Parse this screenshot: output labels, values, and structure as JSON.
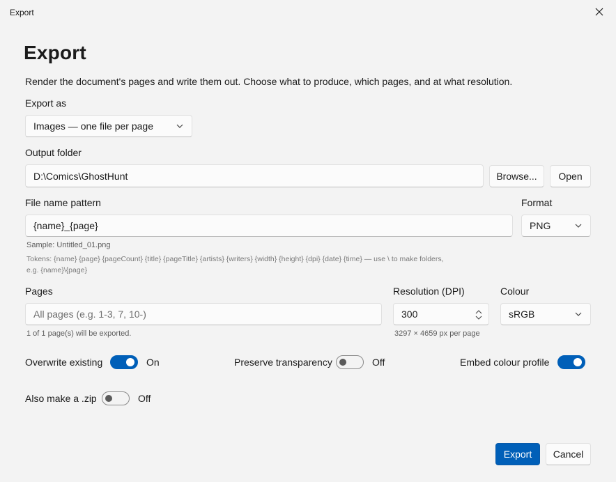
{
  "window": {
    "title": "Export",
    "close_icon": "close-icon"
  },
  "heading": "Export",
  "description": "Render the document's pages and write them out. Choose what to produce, which pages, and at what resolution.",
  "export_as": {
    "label": "Export as",
    "value": "Images — one file per page"
  },
  "output_folder": {
    "label": "Output folder",
    "value": "D:\\Comics\\GhostHunt",
    "browse_label": "Browse...",
    "open_label": "Open"
  },
  "file_name": {
    "label": "File name pattern",
    "value": "{name}_{page}",
    "sample": "Sample: Untitled_01.png",
    "tokens_line1": "Tokens: {name} {page} {pageCount} {title} {pageTitle} {artists} {writers} {width} {height} {dpi} {date} {time} — use \\ to make folders,",
    "tokens_line2": "e.g. {name}\\{page}"
  },
  "format": {
    "label": "Format",
    "value": "PNG"
  },
  "pages": {
    "label": "Pages",
    "placeholder": "All pages (e.g. 1-3, 7, 10-)",
    "hint": "1 of 1 page(s) will be exported."
  },
  "resolution": {
    "label": "Resolution (DPI)",
    "value": "300",
    "hint": "3297 × 4659 px per page"
  },
  "colour": {
    "label": "Colour",
    "value": "sRGB"
  },
  "toggles": {
    "overwrite": {
      "label": "Overwrite existing",
      "state": "On",
      "on": true
    },
    "transparency": {
      "label": "Preserve transparency",
      "state": "Off",
      "on": false
    },
    "embed_profile": {
      "label": "Embed colour profile",
      "on": true
    },
    "zip": {
      "label": "Also make a .zip",
      "state": "Off",
      "on": false
    }
  },
  "actions": {
    "export_label": "Export",
    "cancel_label": "Cancel"
  },
  "colors": {
    "accent": "#005fb8",
    "background": "#f3f3f3"
  }
}
